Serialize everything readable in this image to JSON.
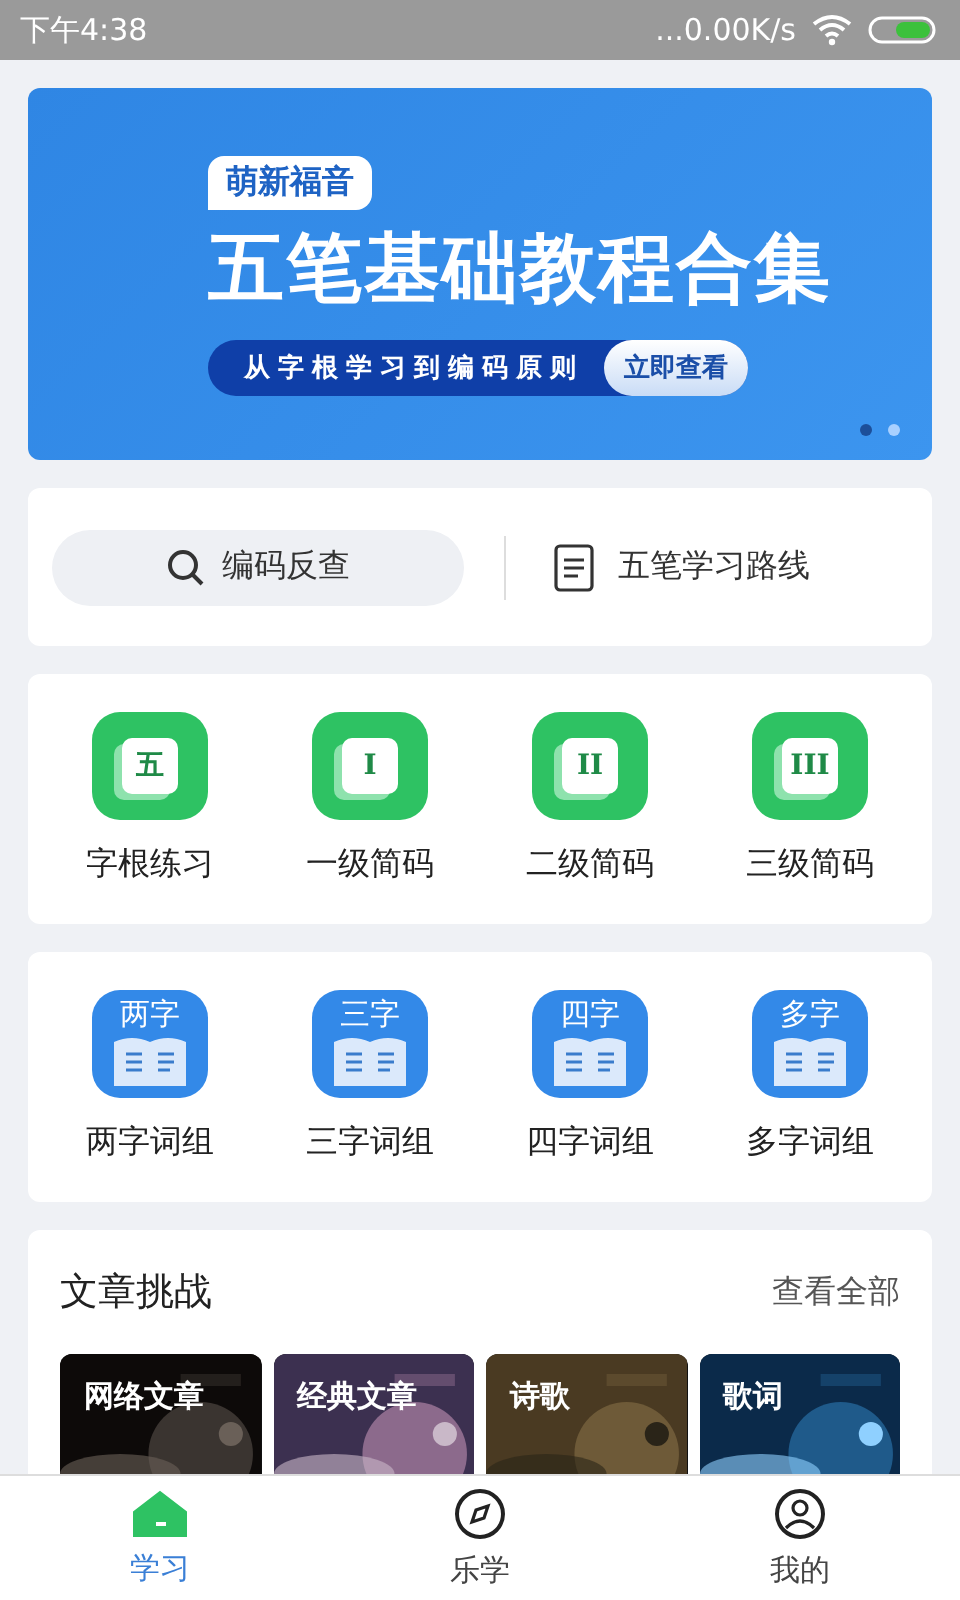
{
  "status_bar": {
    "time": "下午4:38",
    "network_speed": "...0.00K/s"
  },
  "banner": {
    "tag": "萌新福音",
    "title": "五笔基础教程合集",
    "subtitle": "从字根学习到编码原则",
    "button": "立即查看",
    "pages": [
      {
        "selected": true
      },
      {
        "selected": false
      }
    ]
  },
  "search_card": {
    "search": {
      "label": "编码反查"
    },
    "route": {
      "label": "五笔学习路线"
    }
  },
  "code_grid": [
    {
      "glyph": "五",
      "label": "字根练习"
    },
    {
      "glyph": "I",
      "label": "一级简码"
    },
    {
      "glyph": "II",
      "label": "二级简码"
    },
    {
      "glyph": "III",
      "label": "三级简码"
    }
  ],
  "word_grid": [
    {
      "glyph": "两字",
      "label": "两字词组"
    },
    {
      "glyph": "三字",
      "label": "三字词组"
    },
    {
      "glyph": "四字",
      "label": "四字词组"
    },
    {
      "glyph": "多字",
      "label": "多字词组"
    }
  ],
  "articles": {
    "title": "文章挑战",
    "more": "查看全部",
    "items": [
      {
        "label": "网络文章",
        "kind": "picture"
      },
      {
        "label": "经典文章",
        "kind": "picture"
      },
      {
        "label": "诗歌",
        "kind": "picture"
      },
      {
        "label": "歌词",
        "kind": "picture"
      }
    ]
  },
  "bottom_nav": [
    {
      "label": "学习",
      "selected": true
    },
    {
      "label": "乐学",
      "selected": false
    },
    {
      "label": "我的",
      "selected": false
    }
  ]
}
